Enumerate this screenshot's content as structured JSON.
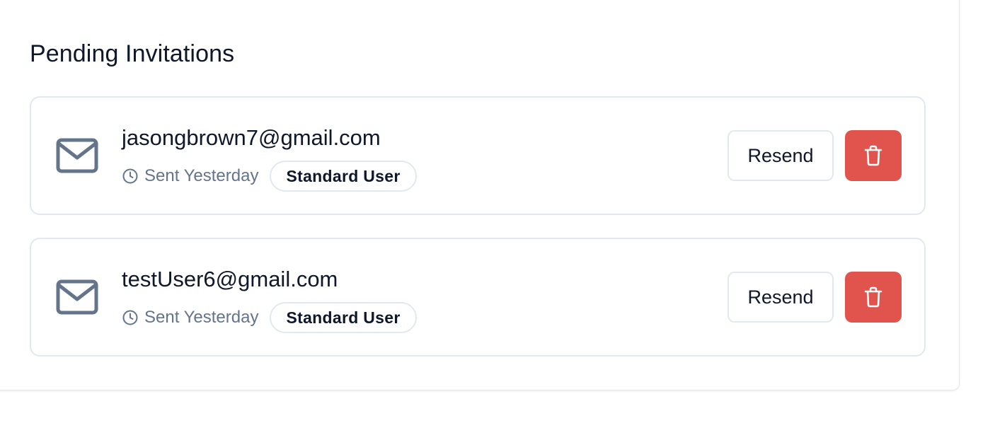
{
  "section": {
    "title": "Pending Invitations"
  },
  "invitations": [
    {
      "email": "jasongbrown7@gmail.com",
      "sent": "Sent Yesterday",
      "role": "Standard User",
      "resend_label": "Resend"
    },
    {
      "email": "testUser6@gmail.com",
      "sent": "Sent Yesterday",
      "role": "Standard User",
      "resend_label": "Resend"
    }
  ],
  "icons": {
    "mail": "mail-icon",
    "clock": "clock-icon",
    "delete": "trash-icon"
  },
  "colors": {
    "danger": "#e0544d",
    "muted_text": "#64748b",
    "border": "#e2e8f0",
    "text": "#0f172a"
  }
}
